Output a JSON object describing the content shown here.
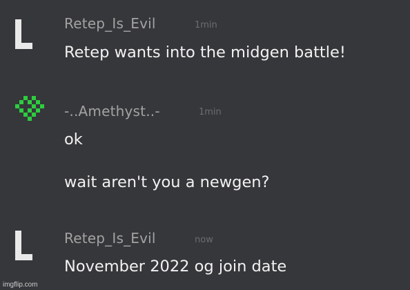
{
  "messages": [
    {
      "username": "Retep_Is_Evil",
      "time": "1min",
      "avatar_icon": "letter-l-avatar-icon",
      "lines": [
        "Retep wants into the midgen battle!"
      ]
    },
    {
      "username": "-..Amethyst..-",
      "time": "1min",
      "avatar_icon": "green-pixel-gem-avatar-icon",
      "lines": [
        "ok",
        "wait aren't you a newgen?"
      ]
    },
    {
      "username": "Retep_Is_Evil",
      "time": "now",
      "avatar_icon": "letter-l-avatar-icon",
      "lines": [
        "November 2022 og join date"
      ]
    }
  ],
  "watermark": "imgflip.com",
  "colors": {
    "background": "#36373a",
    "username": "#a3a3a3",
    "timestamp": "#6d6d6f",
    "message_text": "#f2f2f2",
    "avatar_green": "#2ecc40"
  }
}
